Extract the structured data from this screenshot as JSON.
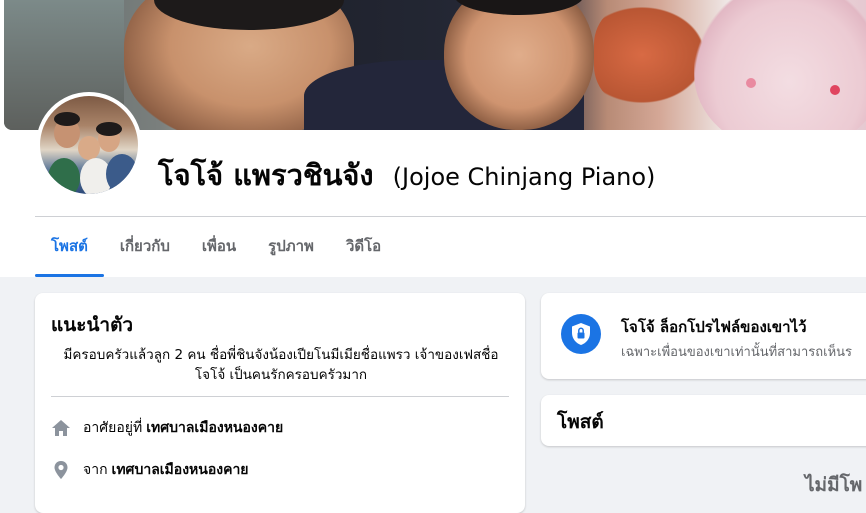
{
  "profile": {
    "name": "โจโจ้ แพรวชินจัง",
    "alternate_name": "(Jojoe Chinjang Piano)"
  },
  "tabs": [
    {
      "label": "โพสต์",
      "active": true
    },
    {
      "label": "เกี่ยวกับ",
      "active": false
    },
    {
      "label": "เพื่อน",
      "active": false
    },
    {
      "label": "รูปภาพ",
      "active": false
    },
    {
      "label": "วิดีโอ",
      "active": false
    }
  ],
  "intro": {
    "title": "แนะนำตัว",
    "bio_line1": "มีครอบครัวแล้วลูก 2 คน ชื่อพี่ชินจังน้องเปียโนมีเมียชื่อแพรว เจ้าของเฟสชื่อ",
    "bio_line2": "โจโจ้ เป็นคนรักครอบครัวมาก",
    "lives_in_prefix": "อาศัยอยู่ที่",
    "lives_in_place": "เทศบาลเมืองหนองคาย",
    "from_prefix": "จาก",
    "from_place": "เทศบาลเมืองหนองคาย"
  },
  "locked_notice": {
    "title": "โจโจ้ ล็อกโปรไฟล์ของเขาไว้",
    "subtitle": "เฉพาะเพื่อนของเขาเท่านั้นที่สามารถเห็นร"
  },
  "posts": {
    "title": "โพสต์",
    "empty_text": "ไม่มีโพ"
  },
  "colors": {
    "accent": "#1b74e4",
    "background": "#f0f2f5",
    "secondary_text": "#65676b"
  },
  "icons": {
    "lock": "shield-lock-icon",
    "home": "home-icon",
    "location": "location-pin-icon"
  }
}
